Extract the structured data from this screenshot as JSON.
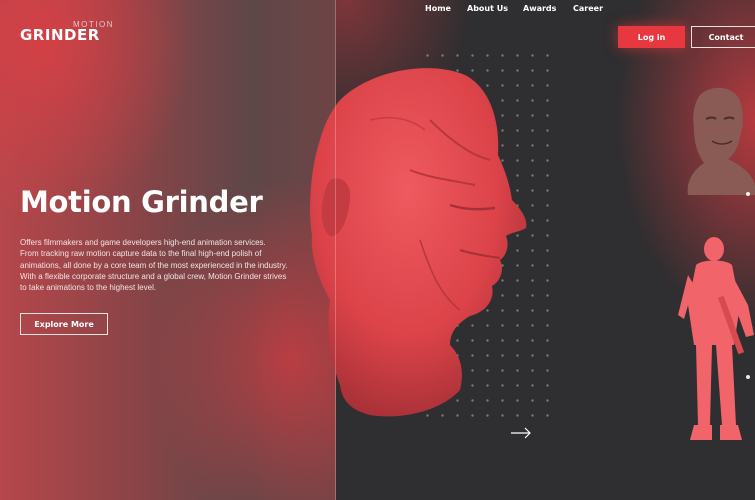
{
  "brand": {
    "small": "MOTION",
    "main": "GRINDER"
  },
  "nav": {
    "items": [
      {
        "label": "Home"
      },
      {
        "label": "About Us"
      },
      {
        "label": "Awards"
      },
      {
        "label": "Career"
      }
    ],
    "login_label": "Log in",
    "contact_label": "Contact"
  },
  "hero": {
    "title": "Motion Grinder",
    "lines": [
      "Offers filmmakers and game developers high-end animation services.",
      "From tracking raw motion capture data to the final high-end polish of",
      "animations, all done by a core team of the most experienced in the industry.",
      "With a flexible corporate structure and a global crew, Motion Grinder strives",
      "to take animations to the highest level."
    ],
    "cta_label": "Explore More"
  },
  "colors": {
    "accent": "#e8383f",
    "sculpture": "#e4474d",
    "background_dark": "#2f2e30"
  },
  "icons": {
    "next_arrow": "arrow-right-icon"
  }
}
